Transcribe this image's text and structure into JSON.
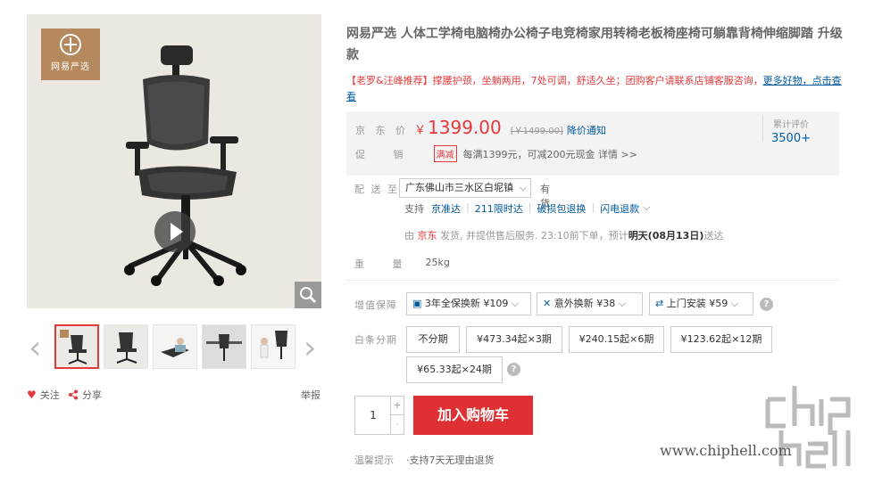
{
  "gallery": {
    "brand_text": "网易严选",
    "follow_label": "关注",
    "share_label": "分享",
    "report_label": "举报"
  },
  "product": {
    "title": "网易严选 人体工学椅电脑椅办公椅子电竞椅家用转椅老板椅座椅可躺靠背椅伸缩脚踏 升级款",
    "promo_text": "【老罗&汪峰推荐】撑腰护颈，坐躺两用，7处可调，舒适久坐；团购客户请联系店铺客服咨询，",
    "promo_link": "更多好物，点击查看"
  },
  "price": {
    "label": "京 东 价",
    "currency": "￥",
    "value": "1399.00",
    "old_price": "[￥1499.00]",
    "notify": "降价通知",
    "rating_label": "累计评价",
    "rating_count": "3500+"
  },
  "promotion": {
    "label": "促 销",
    "tag": "满减",
    "text": "每满1399元，可减200元现金 详情 >>"
  },
  "delivery": {
    "label": "配 送 至",
    "address": "广东佛山市三水区白坭镇",
    "stock": "有货",
    "support_label": "支持",
    "services": [
      "京准达",
      "211限时达",
      "破损包退换",
      "闪电退款"
    ],
    "ship_prefix": "由",
    "ship_seller": "京东",
    "ship_mid": "发货, 并提供售后服务. 23:10前下单，预计",
    "ship_bold": "明天(08月13日)",
    "ship_suffix": "送达"
  },
  "weight": {
    "label": "重 量",
    "value": "25kg"
  },
  "guarantee": {
    "label": "增值保障",
    "options": [
      "3年全保换新 ¥109",
      "意外换新 ¥38",
      "上门安装 ¥59"
    ]
  },
  "installment": {
    "label": "白条分期",
    "options": [
      "不分期",
      "¥473.34起×3期",
      "¥240.15起×6期",
      "¥123.62起×12期",
      "¥65.33起×24期"
    ]
  },
  "purchase": {
    "quantity": "1",
    "plus": "+",
    "minus": "-",
    "cart_label": "加入购物车"
  },
  "tips": {
    "label": "温馨提示",
    "text": "·支持7天无理由退货"
  },
  "watermark": {
    "url": "www.chiphell.com"
  },
  "colors": {
    "accent": "#e4393c",
    "link": "#005aa0",
    "cart": "#df3033"
  }
}
